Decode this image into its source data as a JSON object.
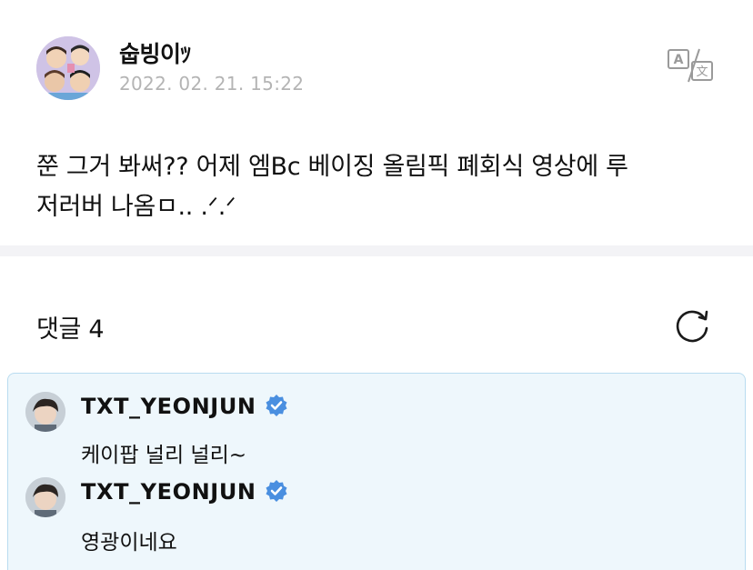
{
  "post": {
    "author": "숩빙이",
    "author_badge": "ﾂ",
    "timestamp": "2022. 02. 21. 15:22",
    "body_line1": "쭌 그거 봐써?? 어제 엠Bc 베이징 올림픽 폐회식 영상에 루",
    "body_line2": "저러버 나옴ㅁ.. .ᐟ.ᐟ",
    "translate_icon": "translate-icon"
  },
  "comments_section": {
    "title": "댓글 4",
    "refresh_icon": "refresh-icon",
    "comments": [
      {
        "author": "TXT_YEONJUN",
        "verified": true,
        "text": "케이팝 널리 널리~"
      },
      {
        "author": "TXT_YEONJUN",
        "verified": true,
        "text": "영광이네요"
      }
    ]
  },
  "colors": {
    "accent_verified": "#4a8fe0",
    "comment_bg": "#eef7fc",
    "comment_border": "#b9dcf0",
    "timestamp": "#b4b4b4",
    "divider": "#f3f3f6"
  }
}
